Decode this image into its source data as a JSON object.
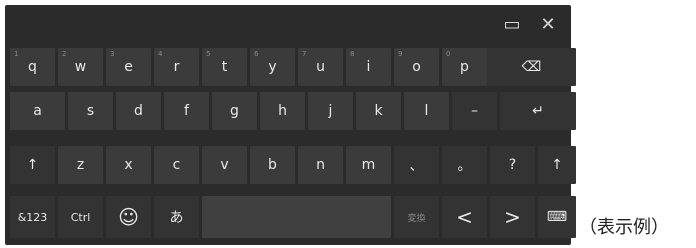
{
  "keyboard": {
    "rows": [
      [
        {
          "name": "key-q",
          "label": "q",
          "hint": "1"
        },
        {
          "name": "key-w",
          "label": "w",
          "hint": "2"
        },
        {
          "name": "key-e",
          "label": "e",
          "hint": "3"
        },
        {
          "name": "key-r",
          "label": "r",
          "hint": "4"
        },
        {
          "name": "key-t",
          "label": "t",
          "hint": "5"
        },
        {
          "name": "key-y",
          "label": "y",
          "hint": "6"
        },
        {
          "name": "key-u",
          "label": "u",
          "hint": "7"
        },
        {
          "name": "key-i",
          "label": "i",
          "hint": "8"
        },
        {
          "name": "key-o",
          "label": "o",
          "hint": "9"
        },
        {
          "name": "key-p",
          "label": "p",
          "hint": "0"
        },
        {
          "name": "backspace-key",
          "label": "⌫",
          "hint": ""
        }
      ],
      [
        {
          "name": "key-a",
          "label": "a"
        },
        {
          "name": "key-s",
          "label": "s"
        },
        {
          "name": "key-d",
          "label": "d"
        },
        {
          "name": "key-f",
          "label": "f"
        },
        {
          "name": "key-g",
          "label": "g"
        },
        {
          "name": "key-h",
          "label": "h"
        },
        {
          "name": "key-j",
          "label": "j"
        },
        {
          "name": "key-k",
          "label": "k"
        },
        {
          "name": "key-l",
          "label": "l"
        },
        {
          "name": "key-dash",
          "label": "–"
        },
        {
          "name": "enter-key",
          "label": "↵"
        }
      ],
      [
        {
          "name": "shift-left-key",
          "label": "↑"
        },
        {
          "name": "key-z",
          "label": "z"
        },
        {
          "name": "key-x",
          "label": "x"
        },
        {
          "name": "key-c",
          "label": "c"
        },
        {
          "name": "key-v",
          "label": "v"
        },
        {
          "name": "key-b",
          "label": "b"
        },
        {
          "name": "key-n",
          "label": "n"
        },
        {
          "name": "key-m",
          "label": "m"
        },
        {
          "name": "key-comma-jp",
          "label": "、"
        },
        {
          "name": "key-period-jp",
          "label": "。"
        },
        {
          "name": "key-question",
          "label": "?"
        },
        {
          "name": "shift-right-key",
          "label": "↑"
        }
      ],
      [
        {
          "name": "symbols-key",
          "label": "&123"
        },
        {
          "name": "ctrl-key",
          "label": "Ctrl"
        },
        {
          "name": "emoji-key",
          "label": "☺"
        },
        {
          "name": "ime-mode-key",
          "label": "あ"
        },
        {
          "name": "space-key",
          "label": ""
        },
        {
          "name": "convert-key",
          "label": "変換"
        },
        {
          "name": "arrow-left-key",
          "label": "<"
        },
        {
          "name": "arrow-right-key",
          "label": ">"
        },
        {
          "name": "keyboard-toggle-key",
          "label": "⌨"
        }
      ]
    ],
    "top_icons": [
      {
        "name": "dock-icon",
        "glyph": "▭"
      },
      {
        "name": "close-icon",
        "glyph": "✕"
      }
    ]
  },
  "caption": "（表示例）"
}
